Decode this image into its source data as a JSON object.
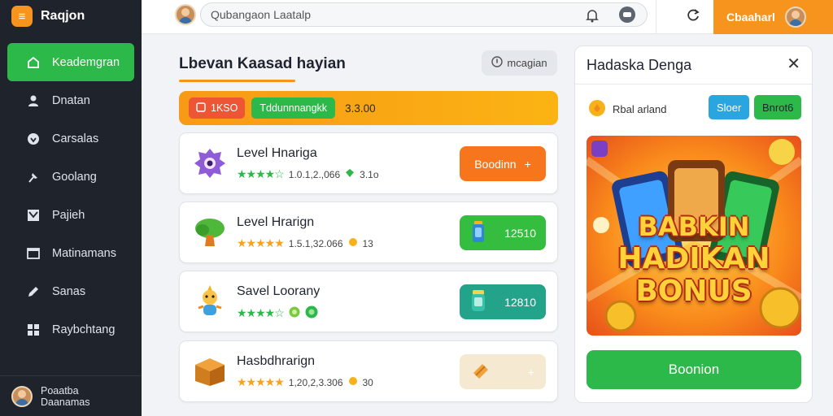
{
  "brand": {
    "name": "Raqjon",
    "logo_letter": "≡"
  },
  "sidebar": {
    "items": [
      {
        "label": "Keademgran",
        "icon": "home-icon"
      },
      {
        "label": "Dnatan",
        "icon": "user-icon"
      },
      {
        "label": "Carsalas",
        "icon": "shield-icon"
      },
      {
        "label": "Goolang",
        "icon": "pin-icon"
      },
      {
        "label": "Pajieh",
        "icon": "chart-icon"
      },
      {
        "label": "Matinamans",
        "icon": "window-icon"
      },
      {
        "label": "Sanas",
        "icon": "pencil-icon"
      },
      {
        "label": "Raybchtang",
        "icon": "grid-icon"
      }
    ],
    "user_name": "Poaatba Daanamas"
  },
  "topbar": {
    "search_value": "Qubangaon Laatalp",
    "cta_label": "Cbaaharl"
  },
  "main": {
    "title": "Lbevan Kaasad hayian",
    "filter_label": "mcagian",
    "strip": {
      "chip_red": "1KSO",
      "chip_green": "Tddunnnangkk",
      "value": "3.3.00"
    },
    "cards": [
      {
        "name": "Level Hnariga",
        "meta": "1.0.1,2.,066",
        "extra": "3.1o",
        "action": "Boodinn",
        "action_icon": "+"
      },
      {
        "name": "Level Hrarign",
        "meta": "1.5.1,32.066",
        "extra": "13",
        "action": "12510",
        "action_icon": "bottle-icon"
      },
      {
        "name": "Savel Loorany",
        "meta": "",
        "extra": "",
        "action": "12810",
        "action_icon": "jar-icon"
      },
      {
        "name": "Hasbdhrarign",
        "meta": "1,20,2,3.306",
        "extra": "30",
        "action": "",
        "action_icon": "+"
      }
    ]
  },
  "panel": {
    "title": "Hadaska Denga",
    "row_label": "Rbal arland",
    "btn_blue": "Sloer",
    "btn_green": "Bnrot6",
    "promo_lines": [
      "BABKIN",
      "HADIKAN",
      "BONUS"
    ],
    "cta": "Boonion"
  },
  "colors": {
    "accent_green": "#2db84a",
    "accent_orange": "#f7941d",
    "sidebar_bg": "#1f232b"
  }
}
